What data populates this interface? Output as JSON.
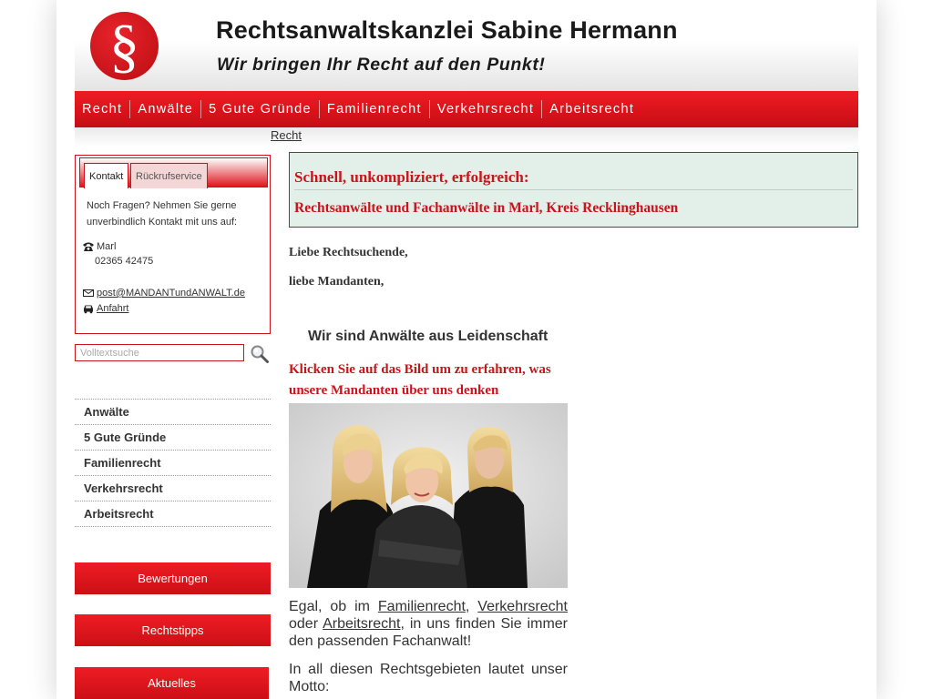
{
  "header": {
    "logo_glyph": "§",
    "title": "Rechtsanwaltskanzlei Sabine Hermann",
    "slogan": "Wir bringen Ihr Recht auf den Punkt!"
  },
  "topnav": {
    "items": [
      {
        "label": "Recht"
      },
      {
        "label": "Anwälte"
      },
      {
        "label": "5 Gute Gründe"
      },
      {
        "label": "Familienrecht"
      },
      {
        "label": "Verkehrsrecht"
      },
      {
        "label": "Arbeitsrecht"
      }
    ]
  },
  "breadcrumb": "Recht",
  "contact": {
    "tabs": [
      "Kontakt",
      "Rückrufservice"
    ],
    "intro": "Noch Fragen? Nehmen Sie gerne unverbindlich Kontakt mit uns auf:",
    "city": "Marl",
    "phone": "02365 42475",
    "email": "post@MANDANTundANWALT.de",
    "directions": "Anfahrt"
  },
  "search": {
    "placeholder": "Volltextsuche"
  },
  "sidenav": {
    "items": [
      "Anwälte",
      "5 Gute Gründe",
      "Familienrecht",
      "Verkehrsrecht",
      "Arbeitsrecht"
    ]
  },
  "buttons": {
    "reviews": "Bewertungen",
    "tips": "Rechtstipps",
    "news": "Aktuelles"
  },
  "main": {
    "hero_title": "Schnell, unkompliziert, erfolgreich:",
    "hero_subtitle": "Rechtsanwälte und Fachanwälte in Marl, Kreis Recklinghausen",
    "greeting1": "Liebe Rechtsuchende,",
    "greeting2": "liebe Mandanten,",
    "section_title": "Wir sind Anwälte aus Leidenschaft",
    "click_hint": "Klicken Sie auf das Bild um zu erfahren, was unsere Mandanten über uns denken",
    "para1": {
      "t1": "Egal, ob im ",
      "link1": "Familienrecht",
      "t2": ", ",
      "link2": "Verkehrsrecht",
      "t3": " oder ",
      "link3": "Arbeitsrecht",
      "t4": ", in uns finden Sie immer den passenden Fachanwalt!"
    },
    "para2": "In all diesen Rechtsgebieten lautet unser Motto:"
  },
  "colors": {
    "accent": "#c8141a",
    "hero_bg": "#e3efe9"
  }
}
